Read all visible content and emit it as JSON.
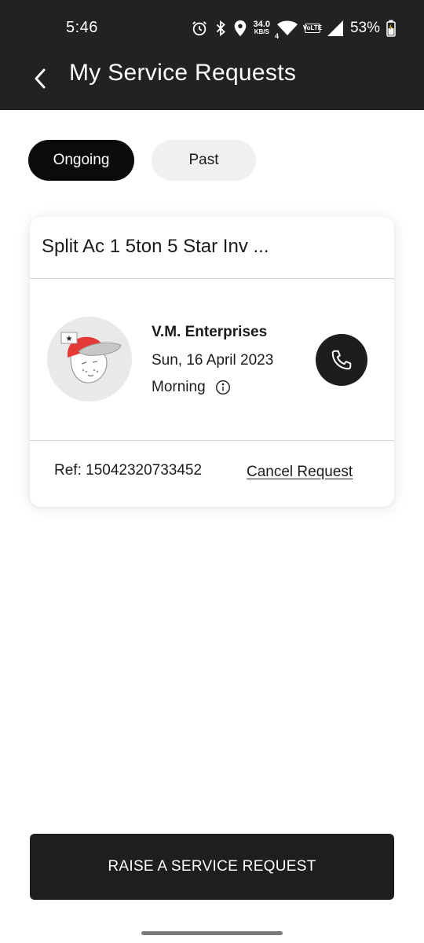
{
  "status_bar": {
    "time": "5:46",
    "net_speed_value": "34.0",
    "net_speed_unit": "KB/S",
    "network_gen": "4",
    "volte_top": "Vo",
    "volte_bottom": "LTE",
    "battery": "53%",
    "icons": [
      "alarm-icon",
      "bluetooth-icon",
      "location-icon",
      "wifi-icon",
      "volte-icon",
      "signal-icon",
      "battery-icon"
    ]
  },
  "app_bar": {
    "title": "My Service Requests",
    "back_icon": "chevron-left-icon"
  },
  "tabs": [
    {
      "label": "Ongoing",
      "active": true
    },
    {
      "label": "Past",
      "active": false
    }
  ],
  "request_card": {
    "product_title": "Split Ac 1 5ton 5 Star Inv ...",
    "vendor": "V.M. Enterprises",
    "date": "Sun, 16 April 2023",
    "slot": "Morning",
    "ref": "Ref: 15042320733452",
    "cancel_label": "Cancel Request",
    "call_icon": "phone-icon",
    "info_icon": "info-icon"
  },
  "footer": {
    "raise_label": "RAISE A SERVICE REQUEST"
  },
  "colors": {
    "topbar": "#222222",
    "active_tab": "#0b0b0b",
    "inactive_tab": "#f0f0f0",
    "button": "#1e1e1e",
    "avatar_hat": "#e53935"
  }
}
